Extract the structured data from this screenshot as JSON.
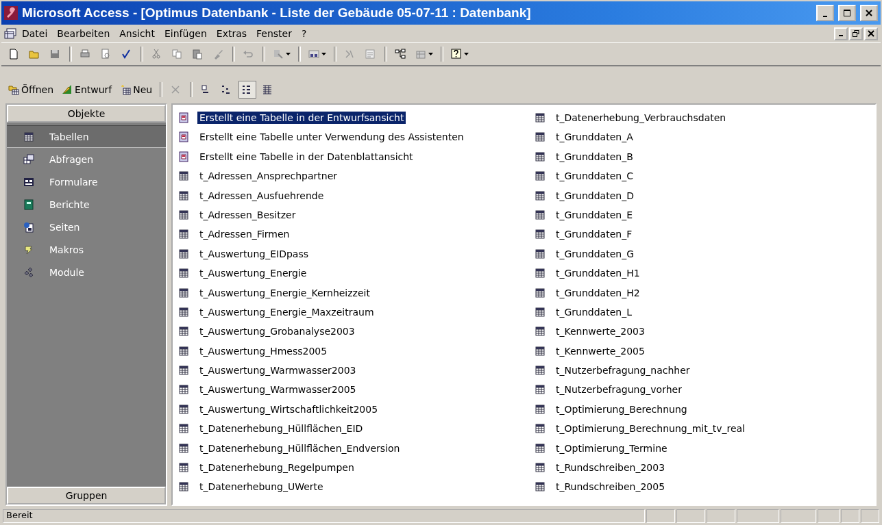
{
  "window": {
    "title": "Microsoft Access - [Optimus Datenbank - Liste der Gebäude 05-07-11 : Datenbank]"
  },
  "menu": [
    "Datei",
    "Bearbeiten",
    "Ansicht",
    "Einfügen",
    "Extras",
    "Fenster",
    "?"
  ],
  "db_toolbar": {
    "buttons": [
      {
        "label": "Öffnen",
        "kind": "open"
      },
      {
        "label": "Entwurf",
        "kind": "design"
      },
      {
        "label": "Neu",
        "kind": "new"
      }
    ],
    "views": [
      {
        "kind": "large",
        "selected": false
      },
      {
        "kind": "small",
        "selected": false
      },
      {
        "kind": "list",
        "selected": true
      },
      {
        "kind": "details",
        "selected": false
      }
    ]
  },
  "sidebar": {
    "header": "Objekte",
    "footer": "Gruppen",
    "items": [
      {
        "label": "Tabellen",
        "kind": "table",
        "selected": true
      },
      {
        "label": "Abfragen",
        "kind": "query",
        "selected": false
      },
      {
        "label": "Formulare",
        "kind": "form",
        "selected": false
      },
      {
        "label": "Berichte",
        "kind": "report",
        "selected": false
      },
      {
        "label": "Seiten",
        "kind": "page",
        "selected": false
      },
      {
        "label": "Makros",
        "kind": "macro",
        "selected": false
      },
      {
        "label": "Module",
        "kind": "module",
        "selected": false
      }
    ]
  },
  "objects": [
    {
      "label": "Erstellt eine Tabelle in der Entwurfsansicht",
      "kind": "wizard",
      "selected": true
    },
    {
      "label": "Erstellt eine Tabelle unter Verwendung des Assistenten",
      "kind": "wizard",
      "selected": false
    },
    {
      "label": "Erstellt eine Tabelle in der Datenblattansicht",
      "kind": "wizard",
      "selected": false
    },
    {
      "label": "t_Adressen_Ansprechpartner",
      "kind": "table",
      "selected": false
    },
    {
      "label": "t_Adressen_Ausfuehrende",
      "kind": "table",
      "selected": false
    },
    {
      "label": "t_Adressen_Besitzer",
      "kind": "table",
      "selected": false
    },
    {
      "label": "t_Adressen_Firmen",
      "kind": "table",
      "selected": false
    },
    {
      "label": "t_Auswertung_EIDpass",
      "kind": "table",
      "selected": false
    },
    {
      "label": "t_Auswertung_Energie",
      "kind": "table",
      "selected": false
    },
    {
      "label": "t_Auswertung_Energie_Kernheizzeit",
      "kind": "table",
      "selected": false
    },
    {
      "label": "t_Auswertung_Energie_Maxzeitraum",
      "kind": "table",
      "selected": false
    },
    {
      "label": "t_Auswertung_Grobanalyse2003",
      "kind": "table",
      "selected": false
    },
    {
      "label": "t_Auswertung_Hmess2005",
      "kind": "table",
      "selected": false
    },
    {
      "label": "t_Auswertung_Warmwasser2003",
      "kind": "table",
      "selected": false
    },
    {
      "label": "t_Auswertung_Warmwasser2005",
      "kind": "table",
      "selected": false
    },
    {
      "label": "t_Auswertung_Wirtschaftlichkeit2005",
      "kind": "table",
      "selected": false
    },
    {
      "label": "t_Datenerhebung_Hüllflächen_EID",
      "kind": "table",
      "selected": false
    },
    {
      "label": "t_Datenerhebung_Hüllflächen_Endversion",
      "kind": "table",
      "selected": false
    },
    {
      "label": "t_Datenerhebung_Regelpumpen",
      "kind": "table",
      "selected": false
    },
    {
      "label": "t_Datenerhebung_UWerte",
      "kind": "table",
      "selected": false
    },
    {
      "label": "t_Datenerhebung_Verbrauchsdaten",
      "kind": "table",
      "selected": false
    },
    {
      "label": "t_Grunddaten_A",
      "kind": "table",
      "selected": false
    },
    {
      "label": "t_Grunddaten_B",
      "kind": "table",
      "selected": false
    },
    {
      "label": "t_Grunddaten_C",
      "kind": "table",
      "selected": false
    },
    {
      "label": "t_Grunddaten_D",
      "kind": "table",
      "selected": false
    },
    {
      "label": "t_Grunddaten_E",
      "kind": "table",
      "selected": false
    },
    {
      "label": "t_Grunddaten_F",
      "kind": "table",
      "selected": false
    },
    {
      "label": "t_Grunddaten_G",
      "kind": "table",
      "selected": false
    },
    {
      "label": "t_Grunddaten_H1",
      "kind": "table",
      "selected": false
    },
    {
      "label": "t_Grunddaten_H2",
      "kind": "table",
      "selected": false
    },
    {
      "label": "t_Grunddaten_L",
      "kind": "table",
      "selected": false
    },
    {
      "label": "t_Kennwerte_2003",
      "kind": "table",
      "selected": false
    },
    {
      "label": "t_Kennwerte_2005",
      "kind": "table",
      "selected": false
    },
    {
      "label": "t_Nutzerbefragung_nachher",
      "kind": "table",
      "selected": false
    },
    {
      "label": "t_Nutzerbefragung_vorher",
      "kind": "table",
      "selected": false
    },
    {
      "label": "t_Optimierung_Berechnung",
      "kind": "table",
      "selected": false
    },
    {
      "label": "t_Optimierung_Berechnung_mit_tv_real",
      "kind": "table",
      "selected": false
    },
    {
      "label": "t_Optimierung_Termine",
      "kind": "table",
      "selected": false
    },
    {
      "label": "t_Rundschreiben_2003",
      "kind": "table",
      "selected": false
    },
    {
      "label": "t_Rundschreiben_2005",
      "kind": "table",
      "selected": false
    }
  ],
  "status_bar": {
    "text": "Bereit"
  }
}
